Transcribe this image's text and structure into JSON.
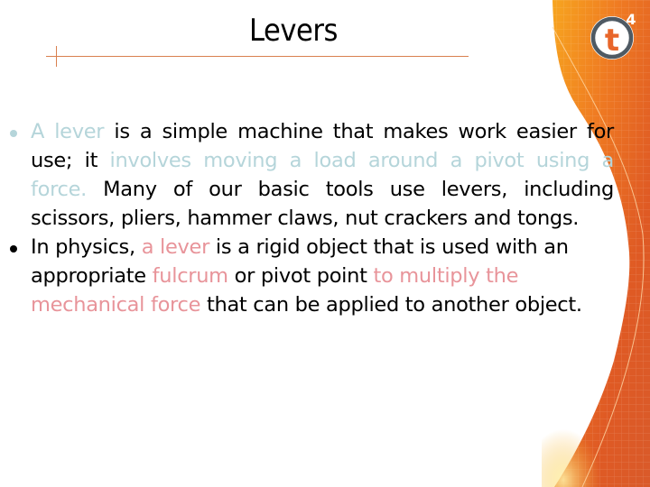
{
  "slide": {
    "title": "Levers",
    "logo": {
      "icon": "t4-logo-icon",
      "letter": "t",
      "superscript": "4"
    },
    "colors": {
      "accent_orange": "#e8662a",
      "rule": "#d9804f",
      "highlight_teal": "#b5d5da",
      "highlight_pink": "#e8949a",
      "text": "#000000"
    },
    "bullets": [
      {
        "segments": [
          {
            "text": "A lever",
            "style": "teal"
          },
          {
            "text": " is a simple machine that makes work easier for use; it ",
            "style": "normal"
          },
          {
            "text": "involves moving a load around a pivot using a force.",
            "style": "teal"
          },
          {
            "text": " Many of our basic tools use levers, including scissors,  pliers, hammer claws, nut crackers and tongs.",
            "style": "normal"
          }
        ]
      },
      {
        "segments": [
          {
            "text": "In physics, ",
            "style": "normal"
          },
          {
            "text": "a lever",
            "style": "pink"
          },
          {
            "text": " is a rigid object that is used with an appropriate ",
            "style": "normal"
          },
          {
            "text": "fulcrum",
            "style": "pink"
          },
          {
            "text": " or pivot point ",
            "style": "normal"
          },
          {
            "text": "to multiply the mechanical force",
            "style": "pink"
          },
          {
            "text": " that can be applied to another object.",
            "style": "normal"
          }
        ]
      }
    ]
  }
}
